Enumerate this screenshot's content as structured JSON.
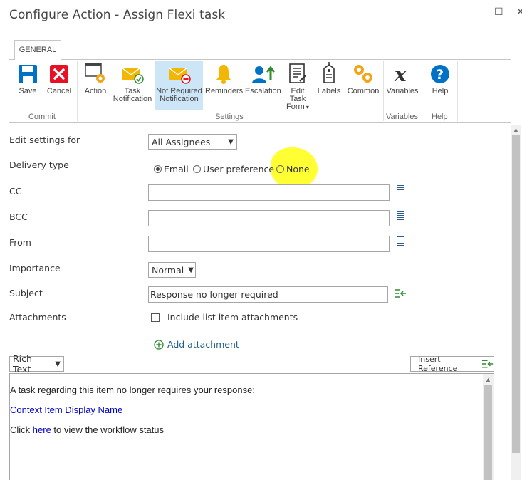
{
  "window": {
    "title": "Configure Action - Assign Flexi task",
    "maximize_glyph": "☐",
    "close_glyph": "✕"
  },
  "ribbon": {
    "tab": "GENERAL",
    "buttons": {
      "save": "Save",
      "cancel": "Cancel",
      "action": "Action",
      "task_notification_1": "Task",
      "task_notification_2": "Notification",
      "not_required_1": "Not Required",
      "not_required_2": "Notification",
      "reminders": "Reminders",
      "escalation": "Escalation",
      "edit_task_form_1": "Edit Task",
      "edit_task_form_2": "Form",
      "labels": "Labels",
      "common": "Common",
      "variables": "Variables",
      "help": "Help"
    },
    "groups": {
      "commit": "Commit",
      "settings": "Settings",
      "variables": "Variables",
      "help": "Help"
    }
  },
  "form": {
    "edit_settings_for": {
      "label": "Edit settings for",
      "value": "All Assignees"
    },
    "delivery_type": {
      "label": "Delivery type",
      "options": [
        "Email",
        "User preference",
        "None"
      ],
      "selected": "Email"
    },
    "cc": {
      "label": "CC",
      "value": ""
    },
    "bcc": {
      "label": "BCC",
      "value": ""
    },
    "from": {
      "label": "From",
      "value": ""
    },
    "importance": {
      "label": "Importance",
      "value": "Normal"
    },
    "subject": {
      "label": "Subject",
      "value": "Response no longer required"
    },
    "attachments": {
      "label": "Attachments",
      "checkbox_label": "Include list item attachments",
      "checked": false
    },
    "add_attachment": "Add attachment"
  },
  "editor": {
    "mode": "Rich Text",
    "insert_reference": "Insert Reference",
    "line1": "A task regarding this item no longer requires your response:",
    "line2_link": "Context Item Display Name",
    "line3_pre": "Click ",
    "line3_link": "here",
    "line3_post": " to view the workflow status"
  },
  "colors": {
    "accent_blue": "#0072c6",
    "cancel_red": "#e81123",
    "selected_bg": "#cde6f7",
    "highlight": "#ffff33",
    "add_green": "#2e8b2e"
  }
}
